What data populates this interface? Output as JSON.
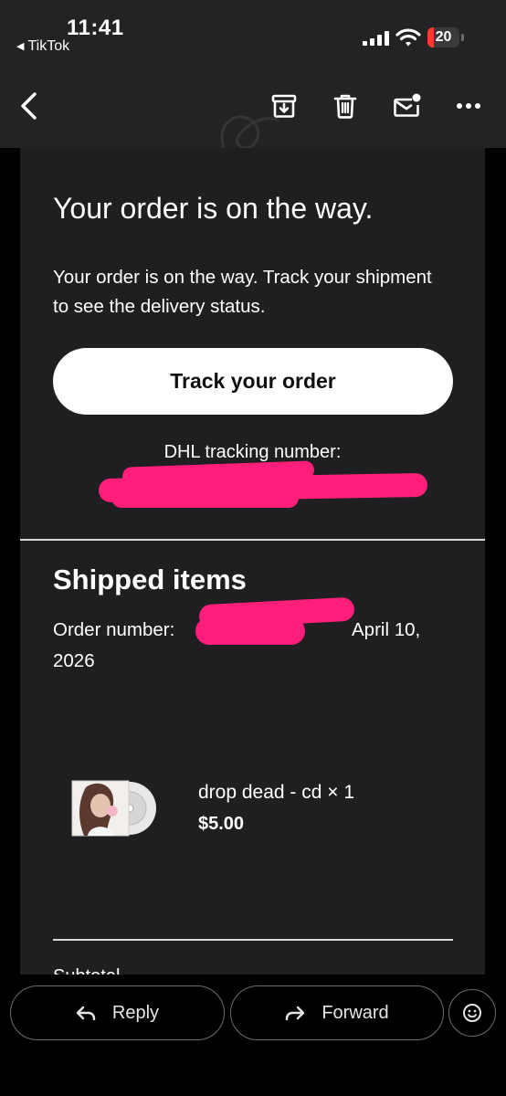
{
  "status_bar": {
    "time": "11:41",
    "back_app": "TikTok",
    "battery_percent": "20",
    "battery_level": 0.2,
    "battery_color": "#ff3b30"
  },
  "toolbar": {
    "back_icon": "chevron-left-icon",
    "archive_icon": "archive-icon",
    "delete_icon": "trash-icon",
    "mark_unread_icon": "mail-unread-icon",
    "more_icon": "more-horizontal-icon"
  },
  "email": {
    "headline": "Your order is on the way.",
    "body": "Your order is on the way. Track your shipment to see the delivery status.",
    "track_button_label": "Track your order",
    "tracking_label": "DHL tracking number:",
    "redaction_color": "#ff1e7a",
    "shipped_title": "Shipped items",
    "order_prefix": "Order number: ",
    "order_date": "April 10, 2026",
    "item": {
      "name": "drop dead - cd × 1",
      "price": "$5.00"
    },
    "next_section_peek": "Subtotal"
  },
  "actions": {
    "reply_label": "Reply",
    "forward_label": "Forward",
    "emoji_icon": "emoji-smile-icon"
  }
}
